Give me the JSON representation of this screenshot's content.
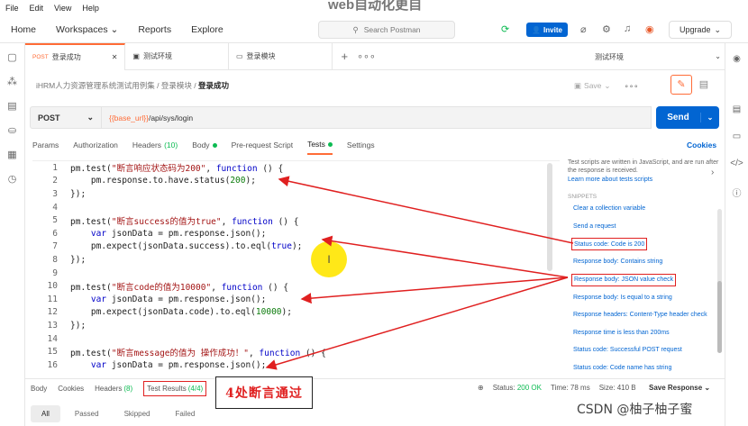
{
  "watermark_top": "web自动化更自",
  "menu": [
    "File",
    "Edit",
    "View",
    "Help"
  ],
  "topnav": {
    "home": "Home",
    "workspaces": "Workspaces",
    "reports": "Reports",
    "explore": "Explore",
    "search_placeholder": "Search Postman",
    "invite": "Invite",
    "upgrade": "Upgrade"
  },
  "tabs": [
    {
      "method": "POST",
      "label": "登录成功"
    },
    {
      "method": "",
      "label": "测试环境"
    },
    {
      "method": "",
      "label": "登录模块"
    }
  ],
  "environment": "测试环境",
  "breadcrumb": {
    "root": "iHRM人力资源管理系统测试用例集",
    "folder": "登录模块",
    "current": "登录成功"
  },
  "save_label": "Save",
  "request": {
    "method": "POST",
    "url_var": "{{base_url}}",
    "url_path": "/api/sys/login",
    "send": "Send"
  },
  "request_tabs": [
    {
      "label": "Params",
      "count": "",
      "dot": false,
      "active": false
    },
    {
      "label": "Authorization",
      "count": "",
      "dot": false,
      "active": false
    },
    {
      "label": "Headers",
      "count": "(10)",
      "dot": false,
      "active": false
    },
    {
      "label": "Body",
      "count": "",
      "dot": true,
      "active": false
    },
    {
      "label": "Pre-request Script",
      "count": "",
      "dot": false,
      "active": false
    },
    {
      "label": "Tests",
      "count": "",
      "dot": true,
      "active": true
    },
    {
      "label": "Settings",
      "count": "",
      "dot": false,
      "active": false
    }
  ],
  "cookies": "Cookies",
  "code_lines": [
    {
      "n": "1",
      "tokens": [
        [
          "fn",
          "pm.test("
        ],
        [
          "str",
          "\"断言响应状态码为200\""
        ],
        [
          "fn",
          ", "
        ],
        [
          "kw",
          "function"
        ],
        [
          "fn",
          " () {"
        ]
      ]
    },
    {
      "n": "2",
      "tokens": [
        [
          "fn",
          "    pm.response.to.have.status("
        ],
        [
          "num",
          "200"
        ],
        [
          "fn",
          ");"
        ]
      ]
    },
    {
      "n": "3",
      "tokens": [
        [
          "fn",
          "});"
        ]
      ]
    },
    {
      "n": "4",
      "tokens": [
        [
          "fn",
          ""
        ]
      ]
    },
    {
      "n": "5",
      "tokens": [
        [
          "fn",
          "pm.test("
        ],
        [
          "str",
          "\"断言success的值为true\""
        ],
        [
          "fn",
          ", "
        ],
        [
          "kw",
          "function"
        ],
        [
          "fn",
          " () {"
        ]
      ]
    },
    {
      "n": "6",
      "tokens": [
        [
          "fn",
          "    "
        ],
        [
          "kw",
          "var"
        ],
        [
          "fn",
          " jsonData = pm.response.json();"
        ]
      ]
    },
    {
      "n": "7",
      "tokens": [
        [
          "fn",
          "    pm.expect(jsonData.success).to.eql("
        ],
        [
          "kw",
          "true"
        ],
        [
          "fn",
          ");"
        ]
      ]
    },
    {
      "n": "8",
      "tokens": [
        [
          "fn",
          "});"
        ]
      ]
    },
    {
      "n": "9",
      "tokens": [
        [
          "fn",
          ""
        ]
      ]
    },
    {
      "n": "10",
      "tokens": [
        [
          "fn",
          "pm.test("
        ],
        [
          "str",
          "\"断言code的值为10000\""
        ],
        [
          "fn",
          ", "
        ],
        [
          "kw",
          "function"
        ],
        [
          "fn",
          " () {"
        ]
      ]
    },
    {
      "n": "11",
      "tokens": [
        [
          "fn",
          "    "
        ],
        [
          "kw",
          "var"
        ],
        [
          "fn",
          " jsonData = pm.response.json();"
        ]
      ]
    },
    {
      "n": "12",
      "tokens": [
        [
          "fn",
          "    pm.expect(jsonData.code).to.eql("
        ],
        [
          "num",
          "10000"
        ],
        [
          "fn",
          ");"
        ]
      ]
    },
    {
      "n": "13",
      "tokens": [
        [
          "fn",
          "});"
        ]
      ]
    },
    {
      "n": "14",
      "tokens": [
        [
          "fn",
          ""
        ]
      ]
    },
    {
      "n": "15",
      "tokens": [
        [
          "fn",
          "pm.test("
        ],
        [
          "str",
          "\"断言message的值为 操作成功！\""
        ],
        [
          "fn",
          ", "
        ],
        [
          "kw",
          "function"
        ],
        [
          "fn",
          " () {"
        ]
      ]
    },
    {
      "n": "16",
      "tokens": [
        [
          "fn",
          "    "
        ],
        [
          "kw",
          "var"
        ],
        [
          "fn",
          " jsonData = pm.response.json();"
        ]
      ]
    }
  ],
  "snippets": {
    "intro": "Test scripts are written in JavaScript, and are run after the response is received.",
    "learn": "Learn more about tests scripts",
    "heading": "SNIPPETS",
    "items": [
      {
        "label": "Clear a collection variable",
        "boxed": false
      },
      {
        "label": "Send a request",
        "boxed": false
      },
      {
        "label": "Status code: Code is 200",
        "boxed": true
      },
      {
        "label": "Response body: Contains string",
        "boxed": false
      },
      {
        "label": "Response body: JSON value check",
        "boxed": true
      },
      {
        "label": "Response body: Is equal to a string",
        "boxed": false
      },
      {
        "label": "Response headers: Content-Type header check",
        "boxed": false
      },
      {
        "label": "Response time is less than 200ms",
        "boxed": false
      },
      {
        "label": "Status code: Successful POST request",
        "boxed": false
      },
      {
        "label": "Status code: Code name has string",
        "boxed": false
      }
    ]
  },
  "response_tabs": [
    {
      "label": "Body",
      "count": "",
      "boxed": false
    },
    {
      "label": "Cookies",
      "count": "",
      "boxed": false
    },
    {
      "label": "Headers",
      "count": "(8)",
      "boxed": false
    },
    {
      "label": "Test Results",
      "count": "(4/4)",
      "boxed": true
    }
  ],
  "annotation": "4处断言通过",
  "status": {
    "status_label": "Status:",
    "status_value": "200 OK",
    "time": "Time: 78 ms",
    "size": "Size: 410 B"
  },
  "save_response": "Save Response",
  "filters": [
    "All",
    "Passed",
    "Skipped",
    "Failed"
  ],
  "csdn_watermark": "CSDN @柚子柚子蜜",
  "colors": {
    "accent": "#ff6c37",
    "primary": "#0265d2",
    "success": "#0cbb52",
    "annotation_red": "#e02020"
  }
}
